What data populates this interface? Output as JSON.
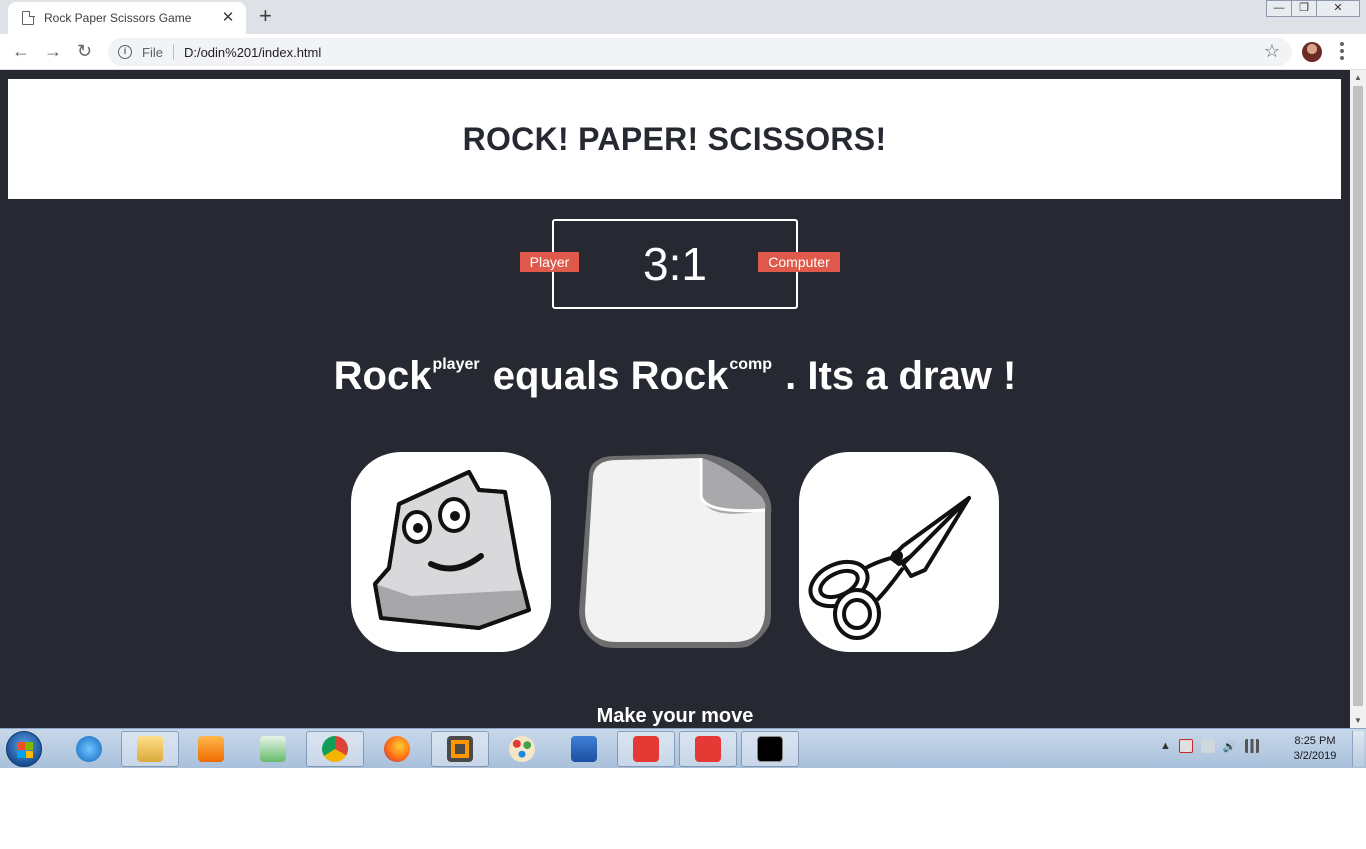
{
  "browser": {
    "tab_title": "Rock Paper Scissors Game",
    "tab_close": "✕",
    "new_tab": "+",
    "scheme_label": "File",
    "url": "D:/odin%201/index.html",
    "window_controls": [
      "—",
      "❐",
      "✕"
    ]
  },
  "page": {
    "header_title": "ROCK! PAPER! SCISSORS!",
    "score": "3:1",
    "player_label": "Player",
    "computer_label": "Computer",
    "result": {
      "player_choice": "Rock",
      "player_tag": "player",
      "middle": "equals",
      "comp_choice": "Rock",
      "comp_tag": "comp",
      "outcome": ". Its a draw !"
    },
    "choices": [
      {
        "name": "rock",
        "icon": "rock-icon"
      },
      {
        "name": "paper",
        "icon": "paper-icon"
      },
      {
        "name": "scissors",
        "icon": "scissors-icon"
      }
    ],
    "prompt": "Make your move"
  },
  "taskbar": {
    "items": [
      "internet-explorer-icon",
      "file-explorer-icon",
      "media-player-icon",
      "notepad-icon",
      "chrome-icon",
      "firefox-icon",
      "sublime-text-icon",
      "paint-icon",
      "word-icon",
      "anydesk-icon",
      "anydesk-icon",
      "cmd-icon"
    ],
    "time": "8:25 PM",
    "date": "3/2/2019"
  },
  "colors": {
    "page_bg": "#262931",
    "label_bg": "#e05a4c",
    "header_bg": "#ffffff"
  }
}
